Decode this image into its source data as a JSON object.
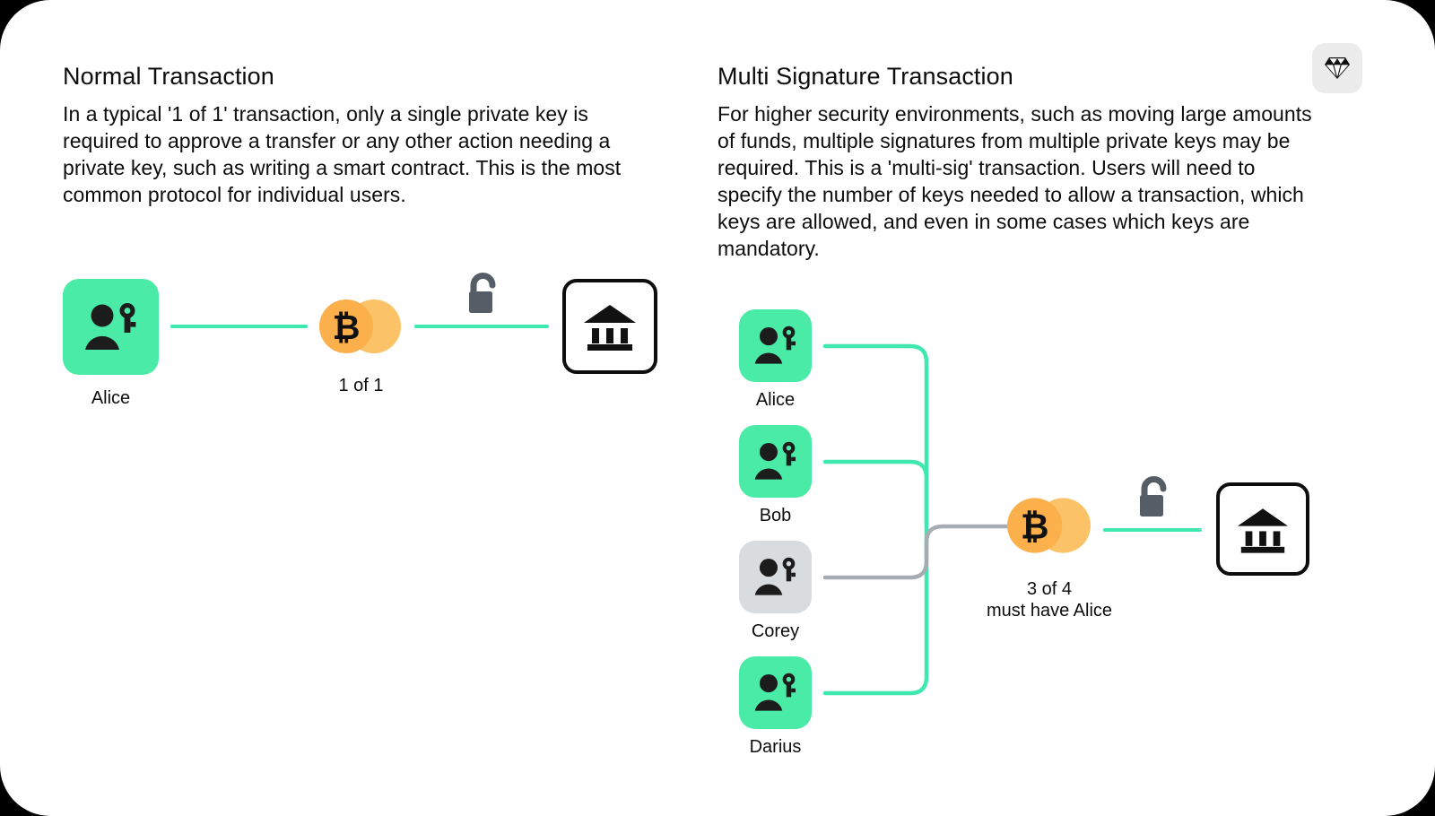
{
  "badge": {
    "icon": "diamond-gem-icon",
    "bg": "#ececec"
  },
  "colors": {
    "tile_green": "#49EBA7",
    "tile_grey": "#D9DCDE",
    "line_green": "#3FE8AE",
    "line_grey": "#A7ACB2",
    "coin_orange": "#FBB council",
    "coin_front": "#FBB04C",
    "coin_back": "#FCC268",
    "lock_grey": "#555D66",
    "text": "#0d0d0d",
    "card_bg": "#ffffff",
    "page_bg": "#000000"
  },
  "left_panel": {
    "title": "Normal Transaction",
    "body": "In a typical '1 of 1' transaction, only a single private key is required to approve a transfer or any other action needing a private key, such as writing a smart contract. This is the most common protocol for individual users.",
    "signer": {
      "name": "Alice",
      "icon": "person-with-key-icon",
      "state": "active"
    },
    "coin": {
      "icon": "bitcoin-coins-icon",
      "symbol": "₿",
      "label": "1 of 1"
    },
    "lock": {
      "icon": "open-padlock-icon"
    },
    "destination": {
      "icon": "bank-icon"
    }
  },
  "right_panel": {
    "title": "Multi Signature Transaction",
    "body": "For higher security environments, such as moving large amounts of funds, multiple signatures from multiple private keys may be required. This is a 'multi-sig' transaction. Users will need to specify the number of keys needed to allow a transaction, which keys are allowed, and even in some cases which keys are mandatory.",
    "signers": [
      {
        "name": "Alice",
        "icon": "person-with-key-icon",
        "state": "active",
        "line": "green"
      },
      {
        "name": "Bob",
        "icon": "person-with-key-icon",
        "state": "active",
        "line": "green"
      },
      {
        "name": "Corey",
        "icon": "person-with-key-icon",
        "state": "inactive",
        "line": "grey"
      },
      {
        "name": "Darius",
        "icon": "person-with-key-icon",
        "state": "active",
        "line": "green"
      }
    ],
    "coin": {
      "icon": "bitcoin-coins-icon",
      "symbol": "₿",
      "label_line1": "3 of 4",
      "label_line2": "must have Alice"
    },
    "lock": {
      "icon": "open-padlock-icon"
    },
    "destination": {
      "icon": "bank-icon"
    }
  },
  "chart_data": {
    "type": "diagram",
    "title": "Normal vs Multi Signature Transaction",
    "flows": [
      {
        "panel": "Normal Transaction",
        "signers": [
          "Alice"
        ],
        "threshold": "1 of 1",
        "destination": "bank"
      },
      {
        "panel": "Multi Signature Transaction",
        "signers": [
          "Alice",
          "Bob",
          "Corey",
          "Darius"
        ],
        "approving": [
          "Alice",
          "Bob",
          "Darius"
        ],
        "declining": [
          "Corey"
        ],
        "threshold": "3 of 4",
        "requirement": "must have Alice",
        "destination": "bank"
      }
    ]
  }
}
